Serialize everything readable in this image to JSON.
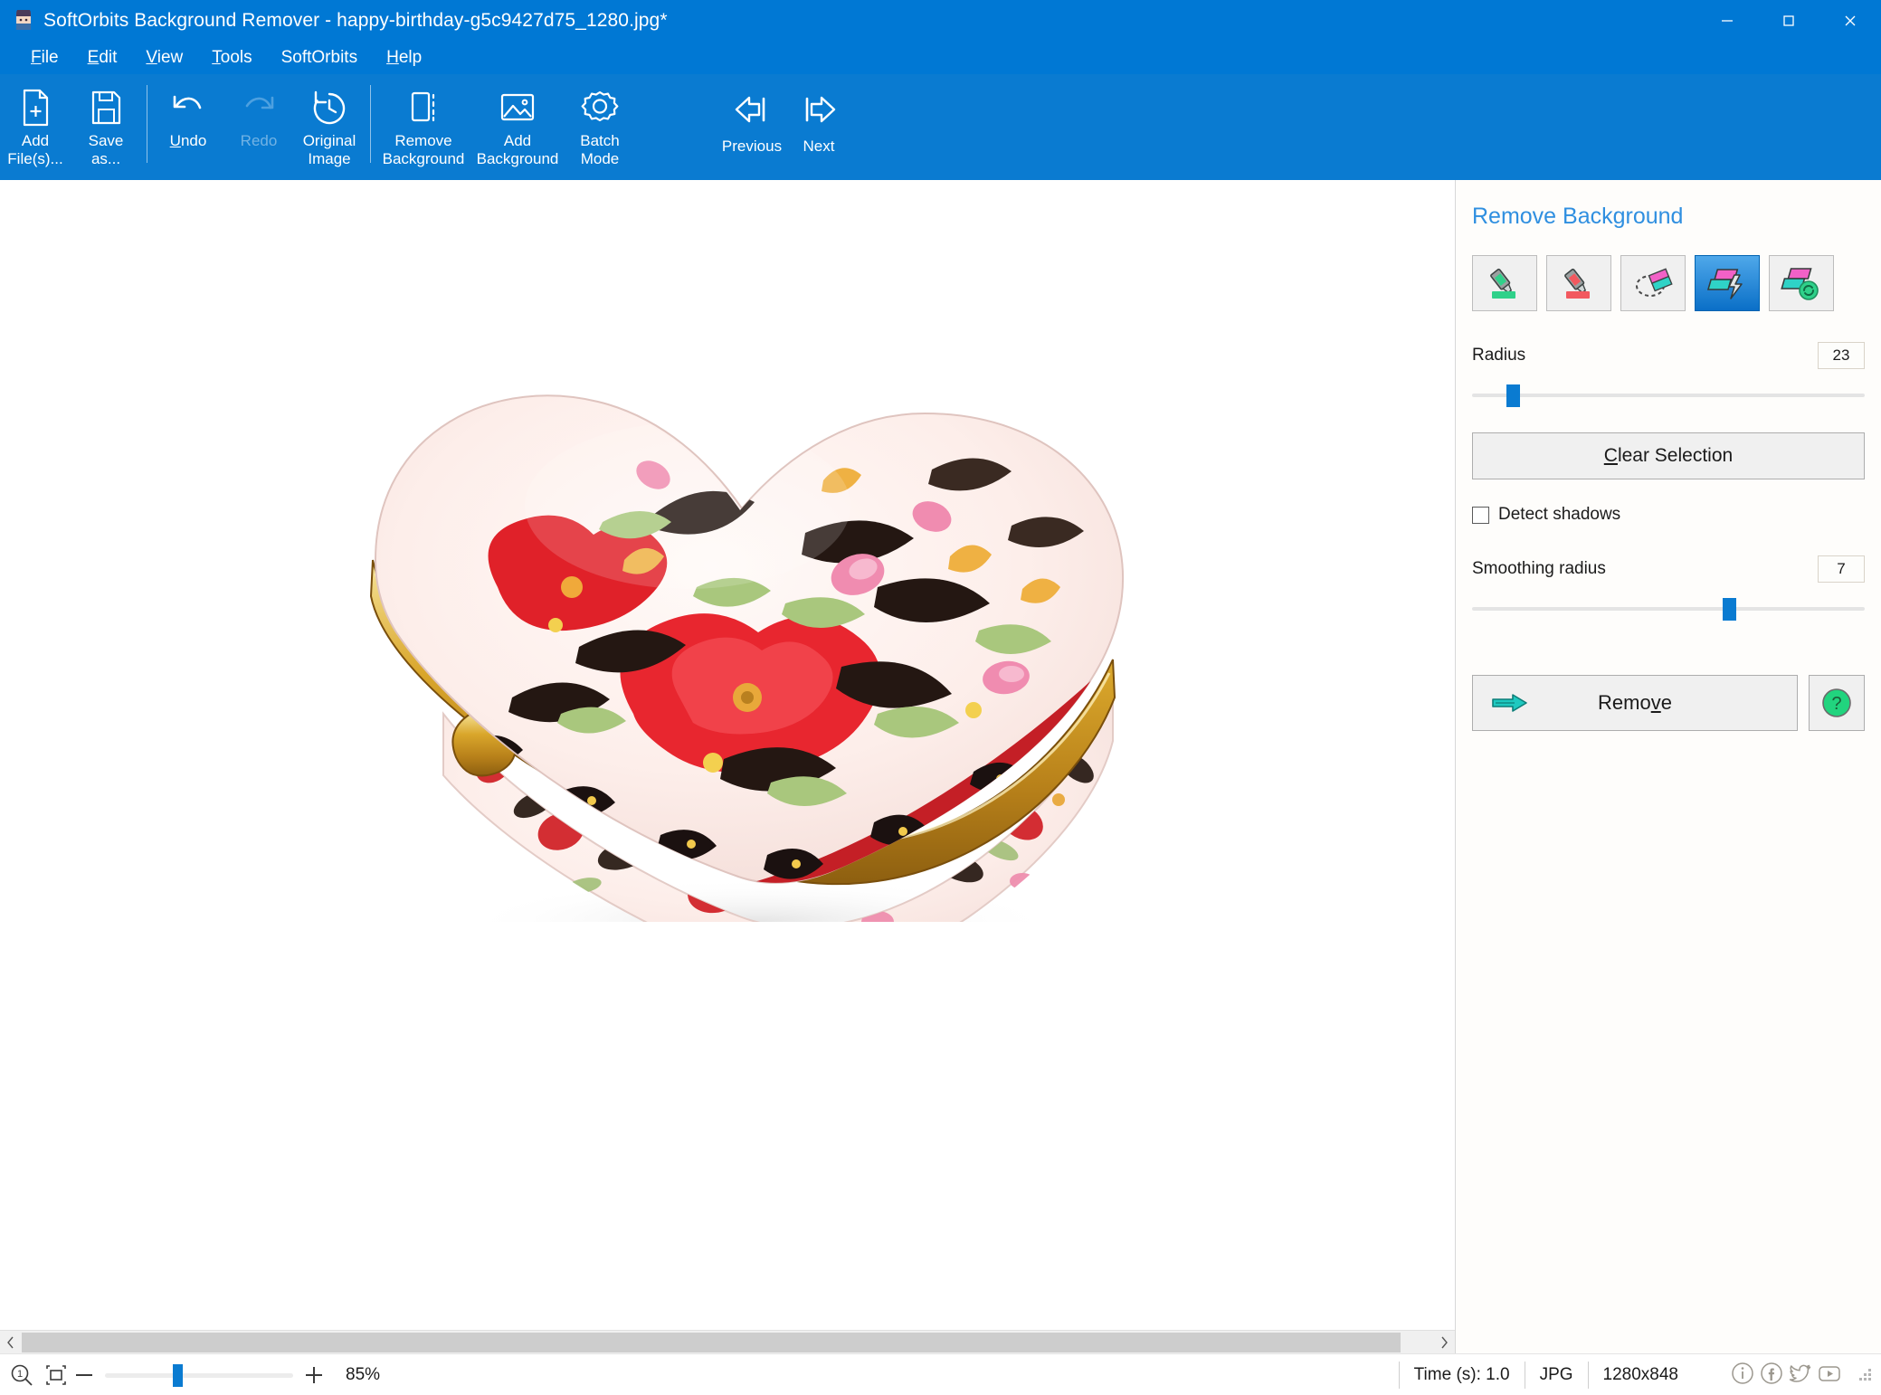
{
  "window": {
    "title": "SoftOrbits Background Remover - happy-birthday-g5c9427d75_1280.jpg*",
    "app_icon": "app-icon",
    "minimize": "minimize-icon",
    "maximize": "maximize-icon",
    "close": "close-icon",
    "titlebar_color": "#0078d4"
  },
  "menu": {
    "items": [
      {
        "label": "File",
        "accel": "F"
      },
      {
        "label": "Edit",
        "accel": "E"
      },
      {
        "label": "View",
        "accel": "V"
      },
      {
        "label": "Tools",
        "accel": "T"
      },
      {
        "label": "SoftOrbits",
        "accel": ""
      },
      {
        "label": "Help",
        "accel": "H"
      }
    ]
  },
  "toolbar": {
    "buttons": [
      {
        "label": "Add\nFile(s)...",
        "icon": "add-file-icon",
        "enabled": true
      },
      {
        "label": "Save\nas...",
        "icon": "save-as-icon",
        "enabled": true
      },
      {
        "label": "Undo",
        "icon": "undo-icon",
        "enabled": true
      },
      {
        "label": "Redo",
        "icon": "redo-icon",
        "enabled": false
      },
      {
        "label": "Original\nImage",
        "icon": "original-image-icon",
        "enabled": true
      },
      {
        "label": "Remove\nBackground",
        "icon": "remove-background-icon",
        "enabled": true
      },
      {
        "label": "Add\nBackground",
        "icon": "add-background-icon",
        "enabled": true
      },
      {
        "label": "Batch\nMode",
        "icon": "batch-mode-icon",
        "enabled": true
      }
    ],
    "nav": [
      {
        "label": "Previous",
        "icon": "previous-arrow-icon"
      },
      {
        "label": "Next",
        "icon": "next-arrow-icon"
      }
    ]
  },
  "panel": {
    "title": "Remove Background",
    "title_color": "#2f8fe0",
    "tools": [
      {
        "name": "marker-keep-tool",
        "icon": "green-marker-icon",
        "selected": false
      },
      {
        "name": "marker-remove-tool",
        "icon": "red-marker-icon",
        "selected": false
      },
      {
        "name": "lasso-select-tool",
        "icon": "lasso-icon",
        "selected": false
      },
      {
        "name": "magic-wand-tool",
        "icon": "magic-bolt-icon",
        "selected": true
      },
      {
        "name": "auto-refresh-tool",
        "icon": "auto-refresh-icon",
        "selected": false
      }
    ],
    "radius": {
      "label": "Radius",
      "value": "23",
      "slider_percent": 9,
      "min": 0,
      "max": 255
    },
    "clear_selection": {
      "label": "Clear Selection",
      "accel": "C"
    },
    "detect_shadows": {
      "label": "Detect shadows",
      "checked": false
    },
    "smoothing_radius": {
      "label": "Smoothing radius",
      "value": "7",
      "slider_percent": 66,
      "min": 0,
      "max": 10
    },
    "remove": {
      "label": "Remove",
      "accel": "v",
      "icon": "right-arrow-icon"
    },
    "help": {
      "icon": "help-question-icon",
      "tooltip": "Help"
    }
  },
  "canvas": {
    "image_alt": "heart-shaped floral porcelain trinket box",
    "background": "#ffffff",
    "scroll_left_arrow": "chevron-left-icon",
    "scroll_right_arrow": "chevron-right-icon"
  },
  "statusbar": {
    "zoom_icon": "zoom-1-to-1-icon",
    "fit_icon": "fit-to-window-icon",
    "zoom_out": "minus-icon",
    "zoom_in": "plus-icon",
    "zoom_percent": "85%",
    "zoom_slider_percent": 38,
    "time": "Time (s): 1.0",
    "format": "JPG",
    "dimensions": "1280x848",
    "social": [
      {
        "name": "info-icon",
        "glyph": "i"
      },
      {
        "name": "facebook-icon",
        "glyph": "f"
      },
      {
        "name": "twitter-icon",
        "glyph": "t"
      },
      {
        "name": "youtube-icon",
        "glyph": "y"
      }
    ]
  }
}
